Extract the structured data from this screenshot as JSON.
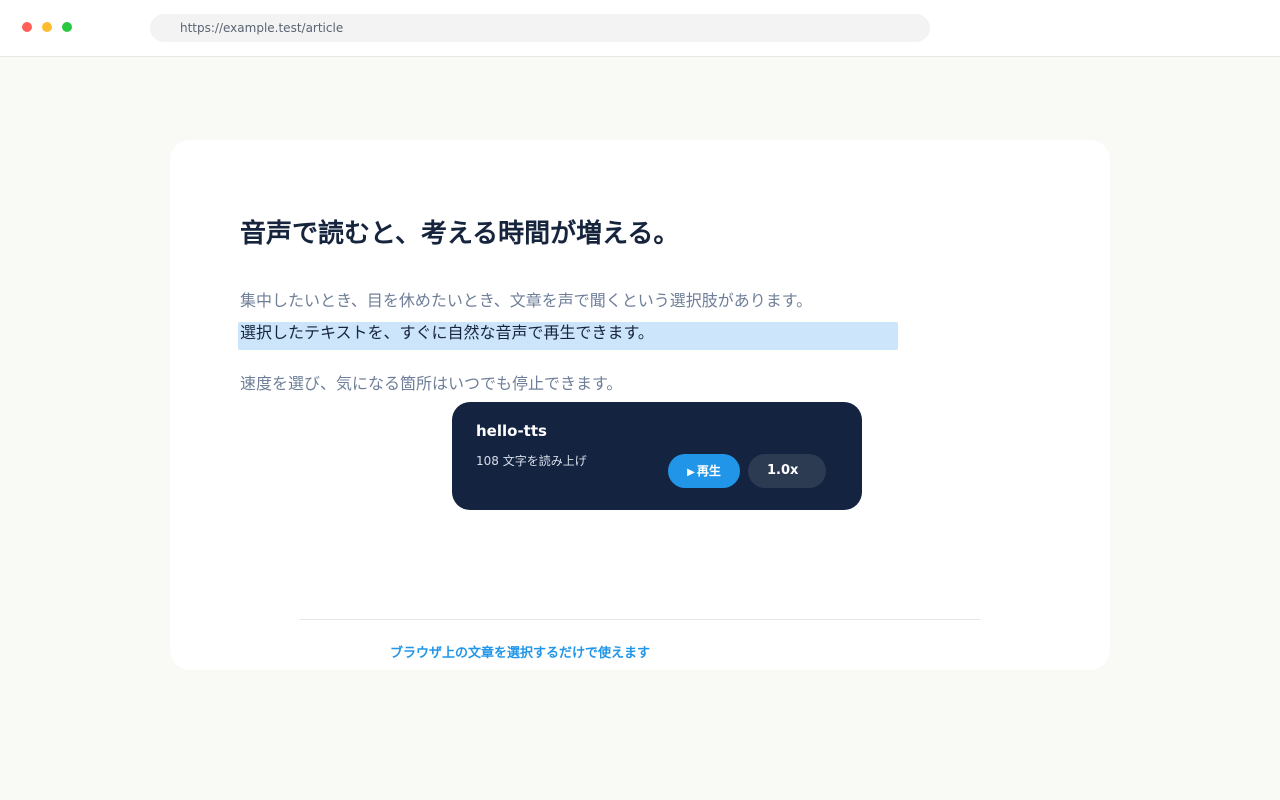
{
  "browser": {
    "url": "https://example.test/article",
    "window_controls": {
      "close_color": "#ff5f57",
      "minimize_color": "#febc2e",
      "maximize_color": "#28c840"
    }
  },
  "article": {
    "title": "音声で読むと、考える時間が増える。",
    "paragraphs": [
      "集中したいとき、目を休めたいとき、文章を声で聞くという選択肢があります。",
      "選択したテキストを、すぐに自然な音声で再生できます。",
      "速度を選び、気になる箇所はいつでも停止できます。"
    ],
    "selected_paragraph_index": 1
  },
  "tts_panel": {
    "name": "hello-tts",
    "char_count_label": "108 文字を読み上げ",
    "play_icon": "play-icon",
    "play_label": "再生",
    "speed_label": "1.0x"
  },
  "footer": {
    "note": "ブラウザ上の文章を選択するだけで使えます"
  },
  "colors": {
    "accent": "#2196e8",
    "selection": "#cce5fa",
    "panel_bg": "#142340",
    "title": "#16253d"
  }
}
